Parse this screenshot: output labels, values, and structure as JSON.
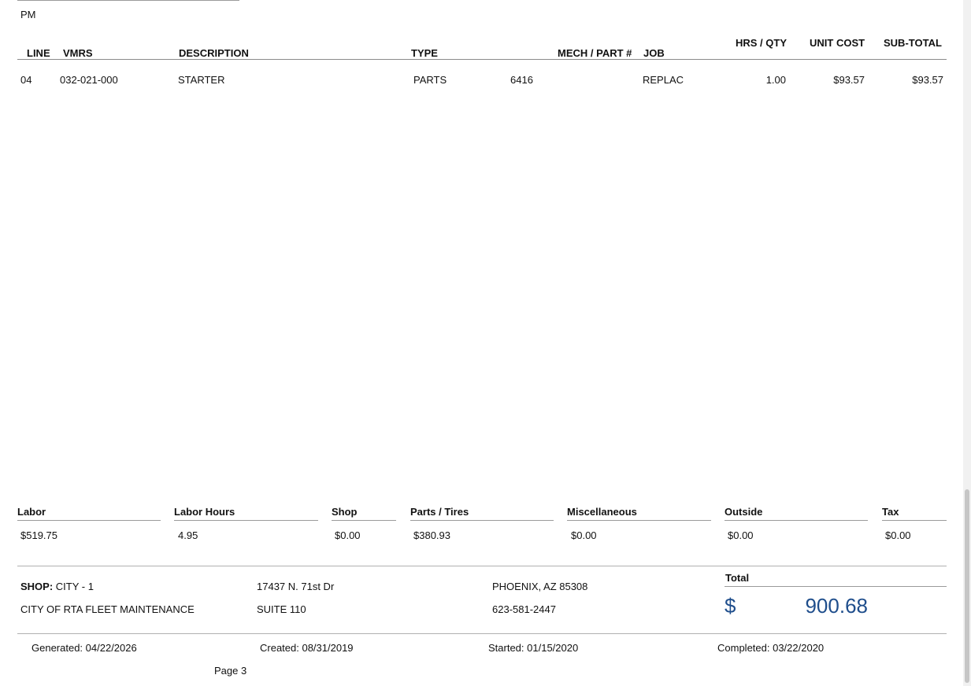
{
  "section_label": "PM",
  "columns": {
    "line": "LINE",
    "vmrs": "VMRS",
    "description": "DESCRIPTION",
    "type": "TYPE",
    "mech_part": "MECH / PART #",
    "job": "JOB",
    "hrs_qty": "HRS / QTY",
    "unit_cost": "UNIT COST",
    "sub_total": "SUB-TOTAL"
  },
  "rows": [
    {
      "line": "04",
      "vmrs": "032-021-000",
      "description": "STARTER",
      "type": "PARTS",
      "part_no": "6416",
      "job": "REPLAC",
      "hrs_qty": "1.00",
      "unit_cost": "$93.57",
      "sub_total": "$93.57"
    }
  ],
  "summary": [
    {
      "label": "Labor",
      "value": "$519.75"
    },
    {
      "label": "Labor Hours",
      "value": "4.95"
    },
    {
      "label": "Shop",
      "value": "$0.00"
    },
    {
      "label": "Parts / Tires",
      "value": "$380.93"
    },
    {
      "label": "Miscellaneous",
      "value": "$0.00"
    },
    {
      "label": "Outside",
      "value": "$0.00"
    },
    {
      "label": "Tax",
      "value": "$0.00"
    }
  ],
  "shop": {
    "label": "SHOP:",
    "name": "CITY - 1",
    "org": "CITY OF RTA FLEET MAINTENANCE",
    "address1": "17437 N. 71st Dr",
    "address2": "SUITE 110",
    "city_state_zip": "PHOENIX, AZ 85308",
    "phone": "623-581-2447"
  },
  "total": {
    "label": "Total",
    "currency_symbol": "$",
    "value": "900.68"
  },
  "dates": {
    "generated": "Generated: 04/22/2026",
    "created": "Created: 08/31/2019",
    "started": "Started: 01/15/2020",
    "completed": "Completed: 03/22/2020"
  },
  "page_label": "Page 3",
  "colors": {
    "total_accent": "#1f4e8c"
  }
}
